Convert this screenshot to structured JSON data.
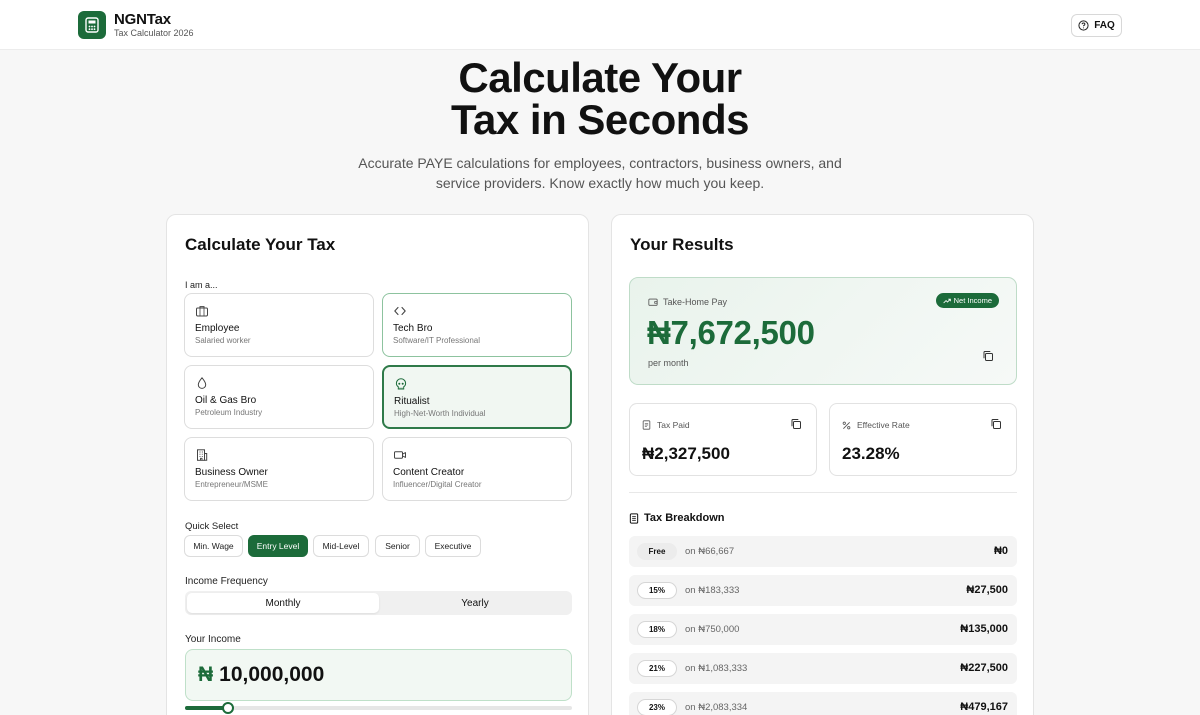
{
  "header": {
    "app_name": "NGNTax",
    "app_subtitle": "Tax Calculator 2026",
    "faq_label": "FAQ"
  },
  "hero": {
    "title_line1": "Calculate Your",
    "title_line2": "Tax in Seconds",
    "subtitle_line1": "Accurate PAYE calculations for employees, contractors, business owners, and",
    "subtitle_line2": "service providers. Know exactly how much you keep."
  },
  "calculator": {
    "title": "Calculate Your Tax",
    "role_label": "I am a...",
    "roles": [
      {
        "title": "Employee",
        "subtitle": "Salaried worker",
        "icon": "briefcase-icon",
        "state": "default"
      },
      {
        "title": "Tech Bro",
        "subtitle": "Software/IT Professional",
        "icon": "code-icon",
        "state": "selected"
      },
      {
        "title": "Oil & Gas Bro",
        "subtitle": "Petroleum Industry",
        "icon": "droplet-icon",
        "state": "default"
      },
      {
        "title": "Ritualist",
        "subtitle": "High-Net-Worth Individual",
        "icon": "skull-icon",
        "state": "active"
      },
      {
        "title": "Business Owner",
        "subtitle": "Entrepreneur/MSME",
        "icon": "building-icon",
        "state": "default"
      },
      {
        "title": "Content Creator",
        "subtitle": "Influencer/Digital Creator",
        "icon": "video-icon",
        "state": "default"
      }
    ],
    "quick_select_label": "Quick Select",
    "quick_select": [
      {
        "label": "Min. Wage",
        "active": false
      },
      {
        "label": "Entry Level",
        "active": true
      },
      {
        "label": "Mid-Level",
        "active": false
      },
      {
        "label": "Senior",
        "active": false
      },
      {
        "label": "Executive",
        "active": false
      }
    ],
    "frequency_label": "Income Frequency",
    "frequency_options": [
      "Monthly",
      "Yearly"
    ],
    "frequency_selected": "Monthly",
    "income_label": "Your Income",
    "currency_symbol": "₦",
    "income_value": "10,000,000",
    "slider_fraction": 0.11
  },
  "results": {
    "title": "Your Results",
    "take_home": {
      "label": "Take-Home Pay",
      "badge": "Net Income",
      "value": "₦7,672,500",
      "period": "per month"
    },
    "tax_paid": {
      "label": "Tax Paid",
      "value": "₦2,327,500"
    },
    "effective_rate": {
      "label": "Effective Rate",
      "value": "23.28%"
    },
    "breakdown_title": "Tax Breakdown",
    "breakdown": [
      {
        "rate": "Free",
        "on": "on ₦66,667",
        "amount": "₦0"
      },
      {
        "rate": "15%",
        "on": "on ₦183,333",
        "amount": "₦27,500"
      },
      {
        "rate": "18%",
        "on": "on ₦750,000",
        "amount": "₦135,000"
      },
      {
        "rate": "21%",
        "on": "on ₦1,083,333",
        "amount": "₦227,500"
      },
      {
        "rate": "23%",
        "on": "on ₦2,083,334",
        "amount": "₦479,167"
      }
    ]
  },
  "colors": {
    "brand_green": "#1c6b3a",
    "light_green": "#f2f8f3"
  }
}
